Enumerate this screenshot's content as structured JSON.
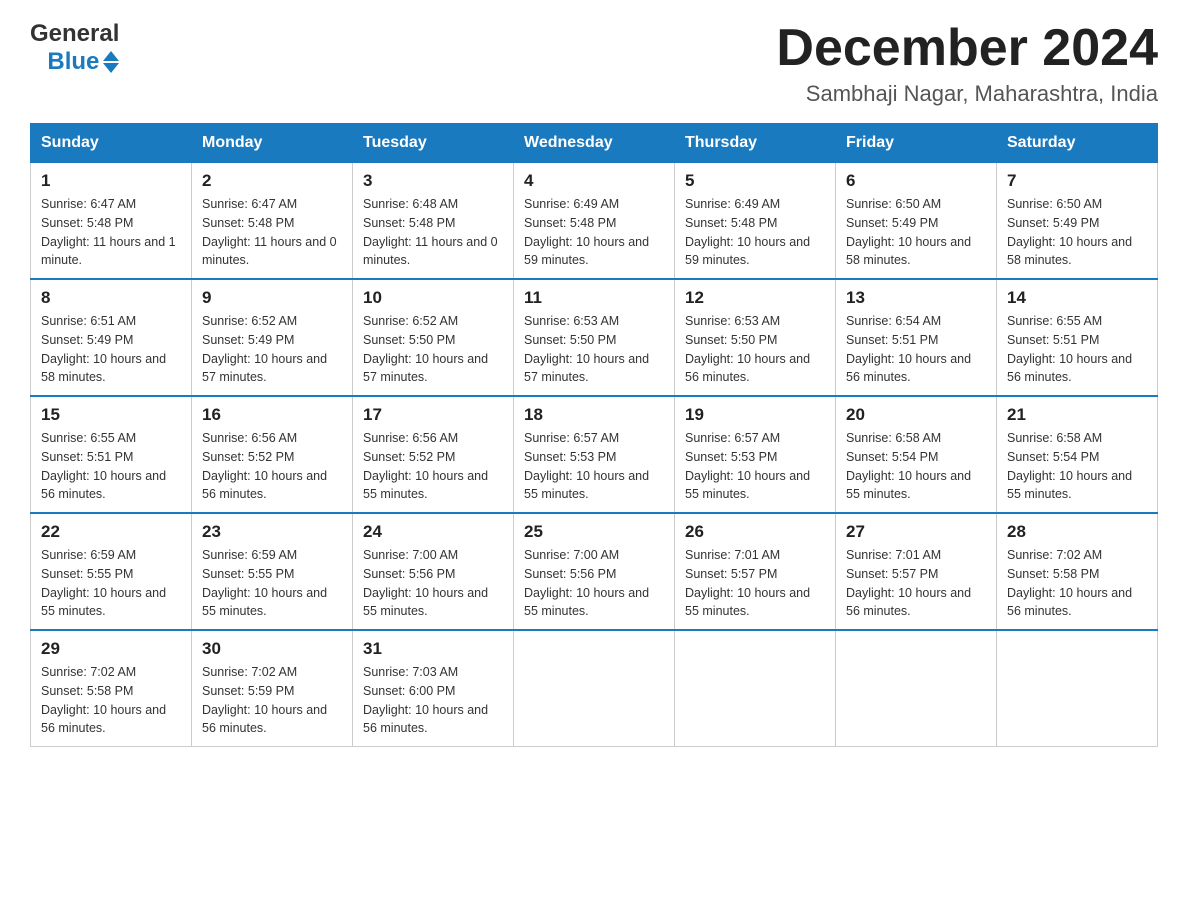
{
  "header": {
    "logo": {
      "text1": "General",
      "text2": "Blue"
    },
    "title": "December 2024",
    "location": "Sambhaji Nagar, Maharashtra, India"
  },
  "days_of_week": [
    "Sunday",
    "Monday",
    "Tuesday",
    "Wednesday",
    "Thursday",
    "Friday",
    "Saturday"
  ],
  "weeks": [
    [
      {
        "day": "1",
        "sunrise": "6:47 AM",
        "sunset": "5:48 PM",
        "daylight": "11 hours and 1 minute."
      },
      {
        "day": "2",
        "sunrise": "6:47 AM",
        "sunset": "5:48 PM",
        "daylight": "11 hours and 0 minutes."
      },
      {
        "day": "3",
        "sunrise": "6:48 AM",
        "sunset": "5:48 PM",
        "daylight": "11 hours and 0 minutes."
      },
      {
        "day": "4",
        "sunrise": "6:49 AM",
        "sunset": "5:48 PM",
        "daylight": "10 hours and 59 minutes."
      },
      {
        "day": "5",
        "sunrise": "6:49 AM",
        "sunset": "5:48 PM",
        "daylight": "10 hours and 59 minutes."
      },
      {
        "day": "6",
        "sunrise": "6:50 AM",
        "sunset": "5:49 PM",
        "daylight": "10 hours and 58 minutes."
      },
      {
        "day": "7",
        "sunrise": "6:50 AM",
        "sunset": "5:49 PM",
        "daylight": "10 hours and 58 minutes."
      }
    ],
    [
      {
        "day": "8",
        "sunrise": "6:51 AM",
        "sunset": "5:49 PM",
        "daylight": "10 hours and 58 minutes."
      },
      {
        "day": "9",
        "sunrise": "6:52 AM",
        "sunset": "5:49 PM",
        "daylight": "10 hours and 57 minutes."
      },
      {
        "day": "10",
        "sunrise": "6:52 AM",
        "sunset": "5:50 PM",
        "daylight": "10 hours and 57 minutes."
      },
      {
        "day": "11",
        "sunrise": "6:53 AM",
        "sunset": "5:50 PM",
        "daylight": "10 hours and 57 minutes."
      },
      {
        "day": "12",
        "sunrise": "6:53 AM",
        "sunset": "5:50 PM",
        "daylight": "10 hours and 56 minutes."
      },
      {
        "day": "13",
        "sunrise": "6:54 AM",
        "sunset": "5:51 PM",
        "daylight": "10 hours and 56 minutes."
      },
      {
        "day": "14",
        "sunrise": "6:55 AM",
        "sunset": "5:51 PM",
        "daylight": "10 hours and 56 minutes."
      }
    ],
    [
      {
        "day": "15",
        "sunrise": "6:55 AM",
        "sunset": "5:51 PM",
        "daylight": "10 hours and 56 minutes."
      },
      {
        "day": "16",
        "sunrise": "6:56 AM",
        "sunset": "5:52 PM",
        "daylight": "10 hours and 56 minutes."
      },
      {
        "day": "17",
        "sunrise": "6:56 AM",
        "sunset": "5:52 PM",
        "daylight": "10 hours and 55 minutes."
      },
      {
        "day": "18",
        "sunrise": "6:57 AM",
        "sunset": "5:53 PM",
        "daylight": "10 hours and 55 minutes."
      },
      {
        "day": "19",
        "sunrise": "6:57 AM",
        "sunset": "5:53 PM",
        "daylight": "10 hours and 55 minutes."
      },
      {
        "day": "20",
        "sunrise": "6:58 AM",
        "sunset": "5:54 PM",
        "daylight": "10 hours and 55 minutes."
      },
      {
        "day": "21",
        "sunrise": "6:58 AM",
        "sunset": "5:54 PM",
        "daylight": "10 hours and 55 minutes."
      }
    ],
    [
      {
        "day": "22",
        "sunrise": "6:59 AM",
        "sunset": "5:55 PM",
        "daylight": "10 hours and 55 minutes."
      },
      {
        "day": "23",
        "sunrise": "6:59 AM",
        "sunset": "5:55 PM",
        "daylight": "10 hours and 55 minutes."
      },
      {
        "day": "24",
        "sunrise": "7:00 AM",
        "sunset": "5:56 PM",
        "daylight": "10 hours and 55 minutes."
      },
      {
        "day": "25",
        "sunrise": "7:00 AM",
        "sunset": "5:56 PM",
        "daylight": "10 hours and 55 minutes."
      },
      {
        "day": "26",
        "sunrise": "7:01 AM",
        "sunset": "5:57 PM",
        "daylight": "10 hours and 55 minutes."
      },
      {
        "day": "27",
        "sunrise": "7:01 AM",
        "sunset": "5:57 PM",
        "daylight": "10 hours and 56 minutes."
      },
      {
        "day": "28",
        "sunrise": "7:02 AM",
        "sunset": "5:58 PM",
        "daylight": "10 hours and 56 minutes."
      }
    ],
    [
      {
        "day": "29",
        "sunrise": "7:02 AM",
        "sunset": "5:58 PM",
        "daylight": "10 hours and 56 minutes."
      },
      {
        "day": "30",
        "sunrise": "7:02 AM",
        "sunset": "5:59 PM",
        "daylight": "10 hours and 56 minutes."
      },
      {
        "day": "31",
        "sunrise": "7:03 AM",
        "sunset": "6:00 PM",
        "daylight": "10 hours and 56 minutes."
      },
      null,
      null,
      null,
      null
    ]
  ]
}
